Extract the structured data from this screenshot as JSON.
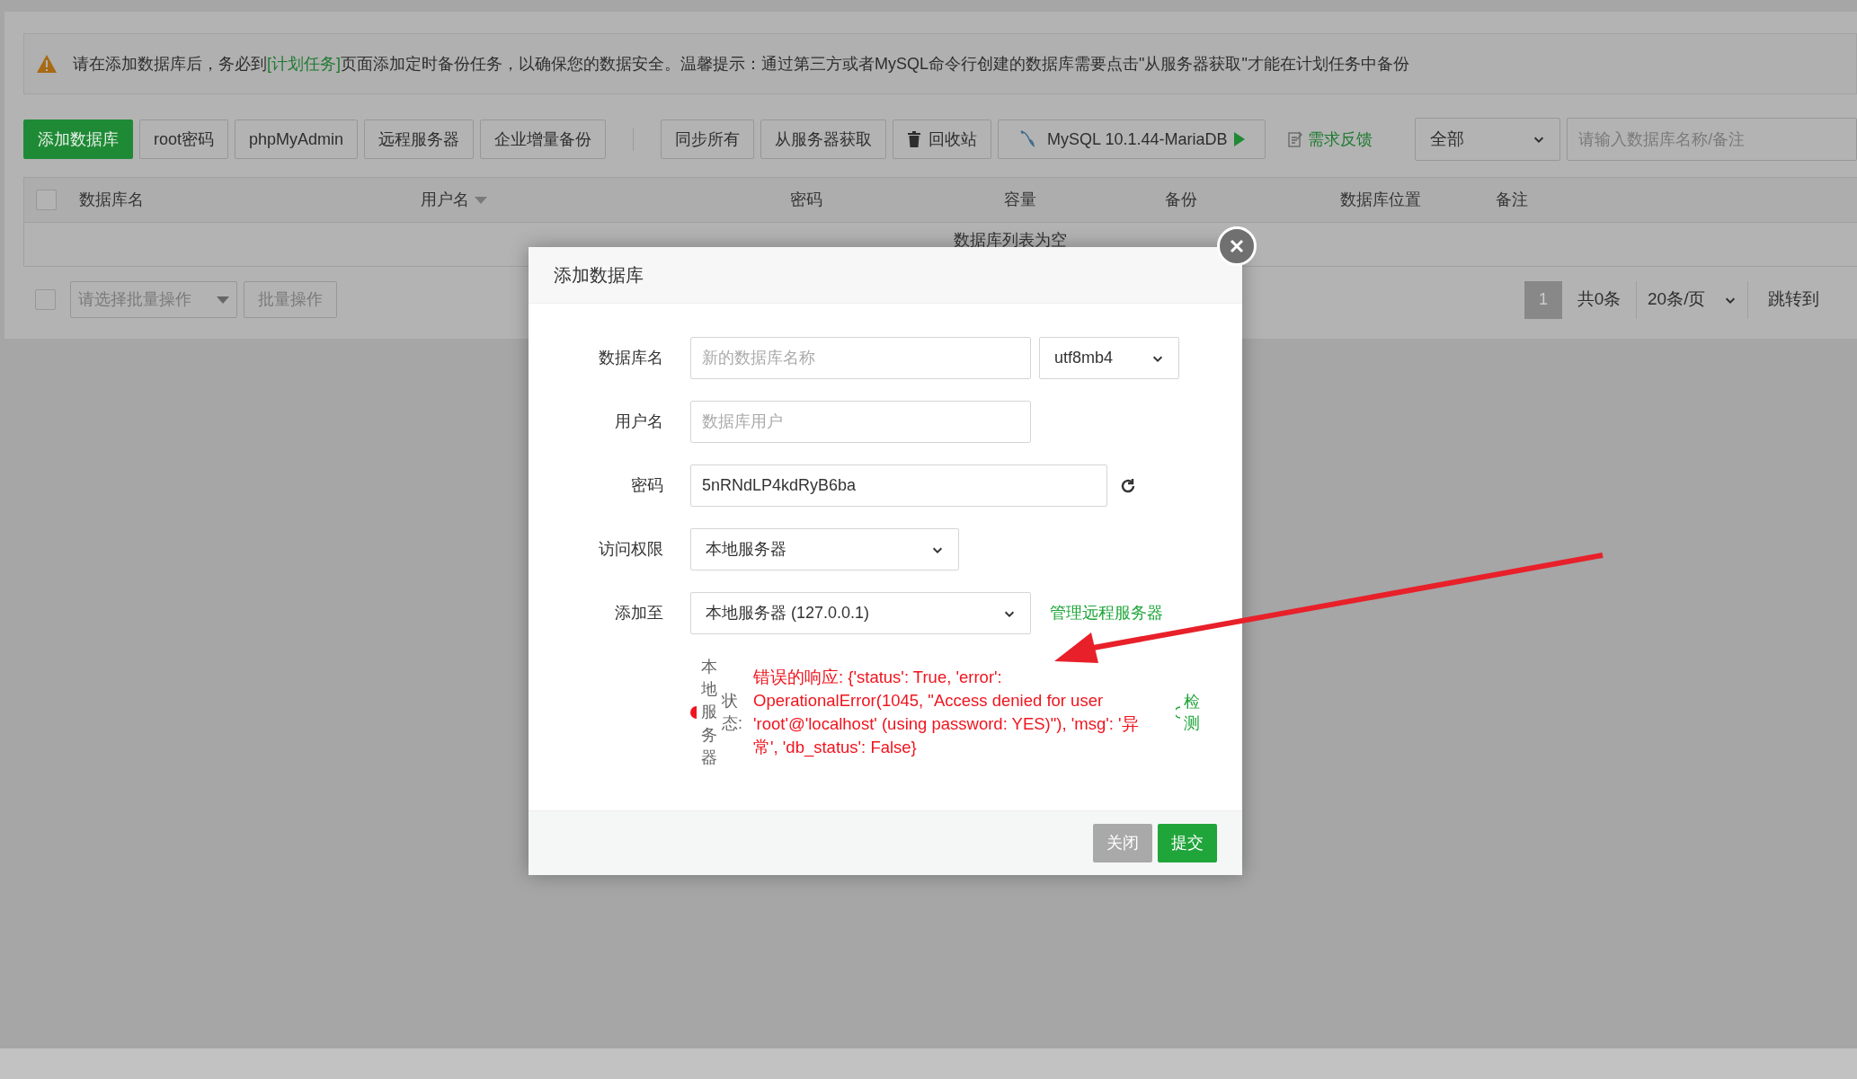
{
  "notice": {
    "before": "请在添加数据库后，务必到",
    "link": "[计划任务]",
    "after": "页面添加定时备份任务，以确保您的数据安全。温馨提示：通过第三方或者MySQL命令行创建的数据库需要点击\"从服务器获取\"才能在计划任务中备份"
  },
  "toolbar": {
    "buttons": [
      {
        "label": "添加数据库",
        "kind": "primary"
      },
      {
        "label": "root密码",
        "kind": "default"
      },
      {
        "label": "phpMyAdmin",
        "kind": "default"
      },
      {
        "label": "远程服务器",
        "kind": "default"
      },
      {
        "label": "企业增量备份",
        "kind": "default"
      },
      {
        "label": "同步所有",
        "kind": "default"
      },
      {
        "label": "从服务器获取",
        "kind": "default"
      },
      {
        "label": "回收站",
        "kind": "trash"
      },
      {
        "label": "MySQL 10.1.44-MariaDB",
        "kind": "mysql"
      }
    ],
    "feedback": "需求反馈",
    "filter": "全部",
    "search": {
      "placeholder": "请输入数据库名称/备注"
    }
  },
  "table": {
    "select_all": {
      "checked": false
    },
    "columns": [
      {
        "label": "数据库名",
        "sort": false
      },
      {
        "label": "用户名",
        "sort": true
      },
      {
        "label": "密码",
        "sort": false
      },
      {
        "label": "容量",
        "sort": false
      },
      {
        "label": "备份",
        "sort": false
      },
      {
        "label": "数据库位置",
        "sort": false
      },
      {
        "label": "备注",
        "sort": false
      }
    ],
    "empty_text": "数据库列表为空"
  },
  "bulk": {
    "checked": false,
    "select": "请选择批量操作",
    "button": "批量操作"
  },
  "pagination": {
    "pages": [
      {
        "label": "1",
        "selected": true
      }
    ],
    "total": "共0条",
    "page_size": "20条/页",
    "jump": "跳转到"
  },
  "modal": {
    "title": "添加数据库",
    "fields": [
      {
        "kind": "text_select",
        "label": "数据库名",
        "placeholder": "新的数据库名称",
        "select": "utf8mb4"
      },
      {
        "kind": "text",
        "label": "用户名",
        "placeholder": "数据库用户"
      },
      {
        "kind": "password",
        "label": "密码",
        "value": "5nRNdLP4kdRyB6ba"
      },
      {
        "kind": "select",
        "label": "访问权限",
        "value": "本地服务器"
      },
      {
        "kind": "select_link",
        "label": "添加至",
        "value": "本地服务器 (127.0.0.1)",
        "link": "管理远程服务器"
      }
    ],
    "status": {
      "ok": false,
      "server": "本地服务器",
      "label": "状态:",
      "message": "错误的响应: {'status': True, 'error': OperationalError(1045, \"Access denied for user 'root'@'localhost' (using password: YES)\"), 'msg': '异常', 'db_status': False}",
      "action": "检测"
    },
    "buttons": [
      {
        "label": "关闭",
        "kind": "secondary"
      },
      {
        "label": "提交",
        "kind": "primary"
      }
    ]
  }
}
